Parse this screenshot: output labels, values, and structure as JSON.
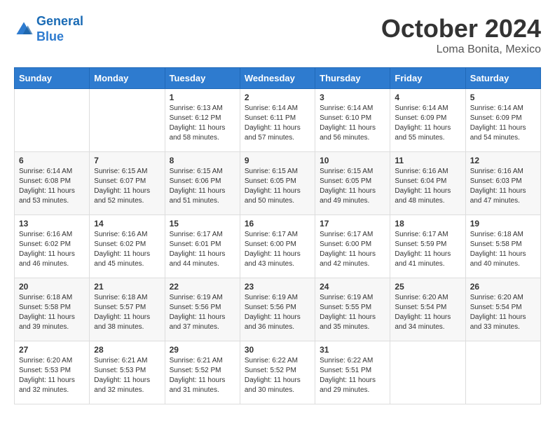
{
  "header": {
    "logo_line1": "General",
    "logo_line2": "Blue",
    "month": "October 2024",
    "location": "Loma Bonita, Mexico"
  },
  "weekdays": [
    "Sunday",
    "Monday",
    "Tuesday",
    "Wednesday",
    "Thursday",
    "Friday",
    "Saturday"
  ],
  "weeks": [
    [
      {
        "day": "",
        "sunrise": "",
        "sunset": "",
        "daylight": ""
      },
      {
        "day": "",
        "sunrise": "",
        "sunset": "",
        "daylight": ""
      },
      {
        "day": "1",
        "sunrise": "Sunrise: 6:13 AM",
        "sunset": "Sunset: 6:12 PM",
        "daylight": "Daylight: 11 hours and 58 minutes."
      },
      {
        "day": "2",
        "sunrise": "Sunrise: 6:14 AM",
        "sunset": "Sunset: 6:11 PM",
        "daylight": "Daylight: 11 hours and 57 minutes."
      },
      {
        "day": "3",
        "sunrise": "Sunrise: 6:14 AM",
        "sunset": "Sunset: 6:10 PM",
        "daylight": "Daylight: 11 hours and 56 minutes."
      },
      {
        "day": "4",
        "sunrise": "Sunrise: 6:14 AM",
        "sunset": "Sunset: 6:09 PM",
        "daylight": "Daylight: 11 hours and 55 minutes."
      },
      {
        "day": "5",
        "sunrise": "Sunrise: 6:14 AM",
        "sunset": "Sunset: 6:09 PM",
        "daylight": "Daylight: 11 hours and 54 minutes."
      }
    ],
    [
      {
        "day": "6",
        "sunrise": "Sunrise: 6:14 AM",
        "sunset": "Sunset: 6:08 PM",
        "daylight": "Daylight: 11 hours and 53 minutes."
      },
      {
        "day": "7",
        "sunrise": "Sunrise: 6:15 AM",
        "sunset": "Sunset: 6:07 PM",
        "daylight": "Daylight: 11 hours and 52 minutes."
      },
      {
        "day": "8",
        "sunrise": "Sunrise: 6:15 AM",
        "sunset": "Sunset: 6:06 PM",
        "daylight": "Daylight: 11 hours and 51 minutes."
      },
      {
        "day": "9",
        "sunrise": "Sunrise: 6:15 AM",
        "sunset": "Sunset: 6:05 PM",
        "daylight": "Daylight: 11 hours and 50 minutes."
      },
      {
        "day": "10",
        "sunrise": "Sunrise: 6:15 AM",
        "sunset": "Sunset: 6:05 PM",
        "daylight": "Daylight: 11 hours and 49 minutes."
      },
      {
        "day": "11",
        "sunrise": "Sunrise: 6:16 AM",
        "sunset": "Sunset: 6:04 PM",
        "daylight": "Daylight: 11 hours and 48 minutes."
      },
      {
        "day": "12",
        "sunrise": "Sunrise: 6:16 AM",
        "sunset": "Sunset: 6:03 PM",
        "daylight": "Daylight: 11 hours and 47 minutes."
      }
    ],
    [
      {
        "day": "13",
        "sunrise": "Sunrise: 6:16 AM",
        "sunset": "Sunset: 6:02 PM",
        "daylight": "Daylight: 11 hours and 46 minutes."
      },
      {
        "day": "14",
        "sunrise": "Sunrise: 6:16 AM",
        "sunset": "Sunset: 6:02 PM",
        "daylight": "Daylight: 11 hours and 45 minutes."
      },
      {
        "day": "15",
        "sunrise": "Sunrise: 6:17 AM",
        "sunset": "Sunset: 6:01 PM",
        "daylight": "Daylight: 11 hours and 44 minutes."
      },
      {
        "day": "16",
        "sunrise": "Sunrise: 6:17 AM",
        "sunset": "Sunset: 6:00 PM",
        "daylight": "Daylight: 11 hours and 43 minutes."
      },
      {
        "day": "17",
        "sunrise": "Sunrise: 6:17 AM",
        "sunset": "Sunset: 6:00 PM",
        "daylight": "Daylight: 11 hours and 42 minutes."
      },
      {
        "day": "18",
        "sunrise": "Sunrise: 6:17 AM",
        "sunset": "Sunset: 5:59 PM",
        "daylight": "Daylight: 11 hours and 41 minutes."
      },
      {
        "day": "19",
        "sunrise": "Sunrise: 6:18 AM",
        "sunset": "Sunset: 5:58 PM",
        "daylight": "Daylight: 11 hours and 40 minutes."
      }
    ],
    [
      {
        "day": "20",
        "sunrise": "Sunrise: 6:18 AM",
        "sunset": "Sunset: 5:58 PM",
        "daylight": "Daylight: 11 hours and 39 minutes."
      },
      {
        "day": "21",
        "sunrise": "Sunrise: 6:18 AM",
        "sunset": "Sunset: 5:57 PM",
        "daylight": "Daylight: 11 hours and 38 minutes."
      },
      {
        "day": "22",
        "sunrise": "Sunrise: 6:19 AM",
        "sunset": "Sunset: 5:56 PM",
        "daylight": "Daylight: 11 hours and 37 minutes."
      },
      {
        "day": "23",
        "sunrise": "Sunrise: 6:19 AM",
        "sunset": "Sunset: 5:56 PM",
        "daylight": "Daylight: 11 hours and 36 minutes."
      },
      {
        "day": "24",
        "sunrise": "Sunrise: 6:19 AM",
        "sunset": "Sunset: 5:55 PM",
        "daylight": "Daylight: 11 hours and 35 minutes."
      },
      {
        "day": "25",
        "sunrise": "Sunrise: 6:20 AM",
        "sunset": "Sunset: 5:54 PM",
        "daylight": "Daylight: 11 hours and 34 minutes."
      },
      {
        "day": "26",
        "sunrise": "Sunrise: 6:20 AM",
        "sunset": "Sunset: 5:54 PM",
        "daylight": "Daylight: 11 hours and 33 minutes."
      }
    ],
    [
      {
        "day": "27",
        "sunrise": "Sunrise: 6:20 AM",
        "sunset": "Sunset: 5:53 PM",
        "daylight": "Daylight: 11 hours and 32 minutes."
      },
      {
        "day": "28",
        "sunrise": "Sunrise: 6:21 AM",
        "sunset": "Sunset: 5:53 PM",
        "daylight": "Daylight: 11 hours and 32 minutes."
      },
      {
        "day": "29",
        "sunrise": "Sunrise: 6:21 AM",
        "sunset": "Sunset: 5:52 PM",
        "daylight": "Daylight: 11 hours and 31 minutes."
      },
      {
        "day": "30",
        "sunrise": "Sunrise: 6:22 AM",
        "sunset": "Sunset: 5:52 PM",
        "daylight": "Daylight: 11 hours and 30 minutes."
      },
      {
        "day": "31",
        "sunrise": "Sunrise: 6:22 AM",
        "sunset": "Sunset: 5:51 PM",
        "daylight": "Daylight: 11 hours and 29 minutes."
      },
      {
        "day": "",
        "sunrise": "",
        "sunset": "",
        "daylight": ""
      },
      {
        "day": "",
        "sunrise": "",
        "sunset": "",
        "daylight": ""
      }
    ]
  ]
}
